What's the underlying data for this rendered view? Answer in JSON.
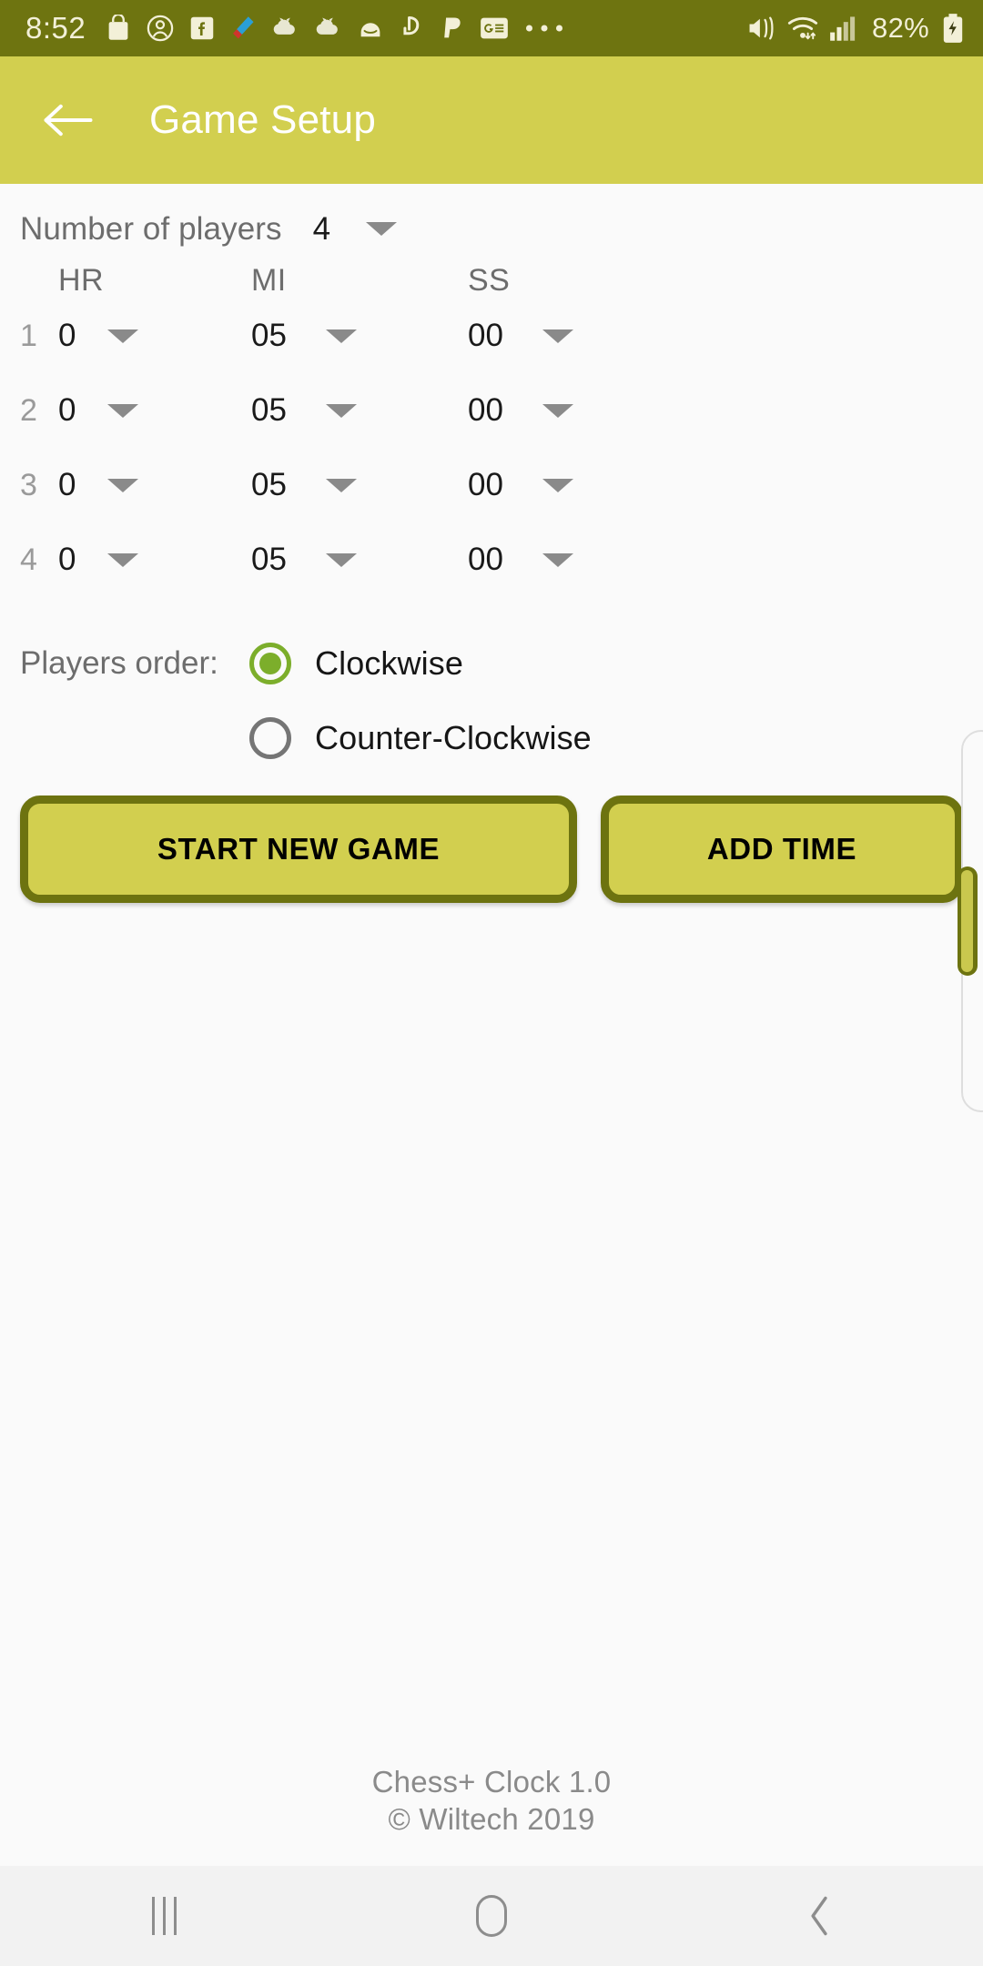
{
  "status_bar": {
    "time": "8:52",
    "battery_percent": "82%",
    "left_icons": [
      "shopping-bag-icon",
      "account-circle-icon",
      "facebook-icon",
      "paint-brush-icon",
      "cloud-app-icon",
      "cloud-app-2-icon",
      "mail-app-icon",
      "hand-gesture-icon",
      "paypal-icon",
      "google-news-icon",
      "more-icons-overflow"
    ],
    "right_icons": [
      "sound-mute-vibrate-icon",
      "wifi-icon",
      "cellular-signal-icon",
      "battery-charging-icon"
    ],
    "colors": {
      "background": "#6e7410",
      "foreground": "#f3f0d8"
    }
  },
  "app_bar": {
    "title": "Game Setup",
    "back_label": "back-arrow",
    "colors": {
      "background": "#d2cf4f",
      "title": "#ffffff"
    }
  },
  "setup": {
    "players_count_label": "Number of players",
    "players_count_value": "4",
    "time_columns": [
      "HR",
      "MI",
      "SS"
    ],
    "time_rows": [
      {
        "num": "1",
        "hr": "0",
        "mi": "05",
        "ss": "00"
      },
      {
        "num": "2",
        "hr": "0",
        "mi": "05",
        "ss": "00"
      },
      {
        "num": "3",
        "hr": "0",
        "mi": "05",
        "ss": "00"
      },
      {
        "num": "4",
        "hr": "0",
        "mi": "05",
        "ss": "00"
      }
    ],
    "order_label": "Players order:",
    "order_options": [
      {
        "label": "Clockwise",
        "selected": true
      },
      {
        "label": "Counter-Clockwise",
        "selected": false
      }
    ],
    "buttons": {
      "start": "START NEW GAME",
      "add_time": "ADD TIME"
    },
    "colors": {
      "button_fill": "#d2cf4f",
      "button_border": "#6d7310",
      "radio_selected": "#7cae2b",
      "radio_unselected": "#757575",
      "page_background": "#fafafa"
    }
  },
  "footer": {
    "app_name": "Chess+ Clock 1.0",
    "copyright": "© Wiltech 2019"
  },
  "nav_bar": {
    "recents_label": "recents-icon",
    "home_label": "home-icon",
    "back_label": "back-icon"
  }
}
